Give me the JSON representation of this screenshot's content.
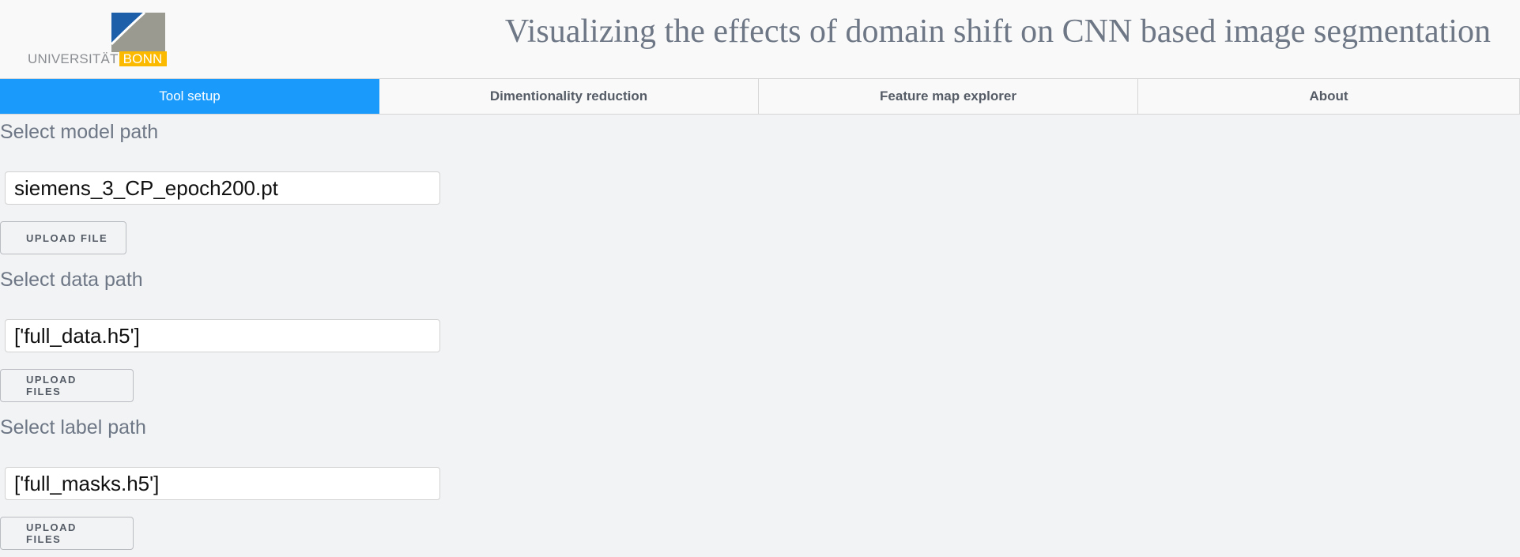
{
  "header": {
    "logo": {
      "text": "UNIVERSITÄT",
      "highlight": "BONN",
      "colors": {
        "blue": "#1e5fa9",
        "grey": "#9a9a91",
        "yellow": "#fbb900"
      }
    },
    "title": "Visualizing the effects of domain shift on CNN based image segmentation"
  },
  "tabs": [
    {
      "label": "Tool setup",
      "active": true
    },
    {
      "label": "Dimentionality reduction",
      "active": false
    },
    {
      "label": "Feature map explorer",
      "active": false
    },
    {
      "label": "About",
      "active": false
    }
  ],
  "model": {
    "label": "Select model path",
    "value": "siemens_3_CP_epoch200.pt",
    "button": "UPLOAD FILE"
  },
  "data": {
    "label": "Select data path",
    "value": "['full_data.h5']",
    "button": "UPLOAD FILES"
  },
  "labels": {
    "label": "Select label path",
    "value": "['full_masks.h5']",
    "button": "UPLOAD FILES"
  },
  "colors": {
    "accent": "#1a9bfc",
    "background": "#f2f3f5",
    "text_muted": "#6e7785"
  }
}
